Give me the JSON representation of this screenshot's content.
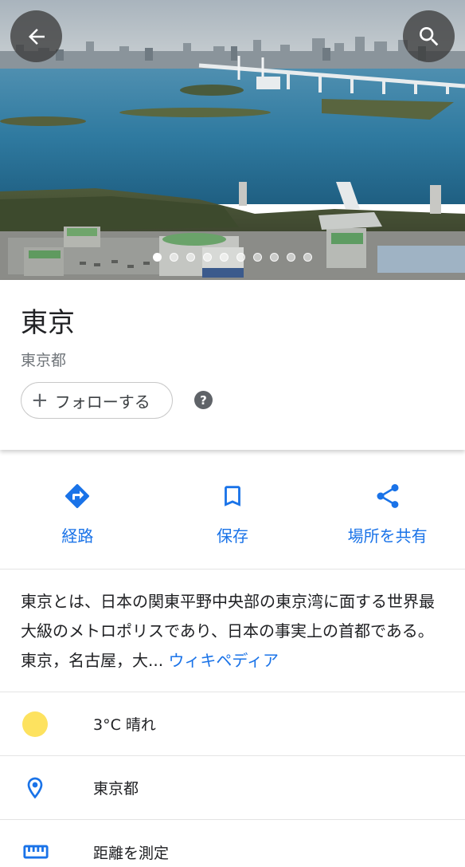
{
  "hero": {
    "photo_count": 10,
    "active_photo_index": 0
  },
  "icons": {
    "back": "arrow-back-icon",
    "search": "search-icon",
    "help": "help-icon",
    "directions": "directions-icon",
    "save": "bookmark-icon",
    "share": "share-icon",
    "weather": "sun-icon",
    "location": "location-pin-icon",
    "measure": "ruler-icon"
  },
  "place": {
    "title": "東京",
    "subtitle": "東京都",
    "follow_label": "フォローする",
    "help_glyph": "?"
  },
  "actions": [
    {
      "label": "経路"
    },
    {
      "label": "保存"
    },
    {
      "label": "場所を共有"
    }
  ],
  "description": {
    "text": "東京とは、日本の関東平野中央部の東京湾に面する世界最大級のメトロポリスであり、日本の事実上の首都である。東京，名古屋，大...",
    "source_link": "ウィキペディア"
  },
  "rows": {
    "weather": "3°C 晴れ",
    "location": "東京都",
    "measure": "距離を測定"
  },
  "colors": {
    "accent": "#1a73e8",
    "sun": "#fde25f",
    "overlay_button": "#3c3c3c"
  }
}
